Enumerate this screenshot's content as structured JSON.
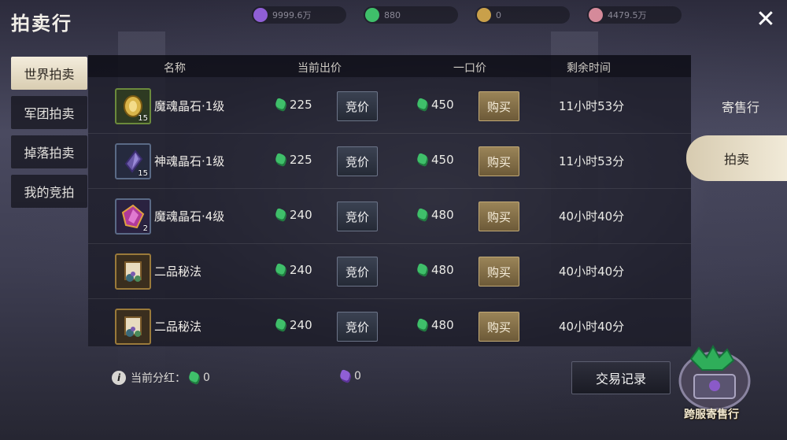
{
  "title": "拍卖行",
  "currencies": [
    {
      "value": "9999.6万",
      "color": "#8f5fd6",
      "icon": "purple-gem-icon"
    },
    {
      "value": "880",
      "color": "#3fbf6a",
      "icon": "green-gem-icon"
    },
    {
      "value": "0",
      "color": "#c9a04a",
      "icon": "gold-coin-icon"
    },
    {
      "value": "4479.5万",
      "color": "#d58a9a",
      "icon": "pink-orb-icon"
    }
  ],
  "left_tabs": [
    "世界拍卖",
    "军团拍卖",
    "掉落拍卖",
    "我的竞拍"
  ],
  "table": {
    "headers": {
      "name": "名称",
      "bid": "当前出价",
      "buyout": "一口价",
      "time": "剩余时间"
    },
    "bid_label": "竞价",
    "buy_label": "购买",
    "rows": [
      {
        "name": "魔魂晶石·1级",
        "count": "15",
        "bid": "225",
        "buyout": "450",
        "time": "11小时53分",
        "icon": "gold-crystal-icon",
        "frame": "#6b8a3c"
      },
      {
        "name": "神魂晶石·1级",
        "count": "15",
        "bid": "225",
        "buyout": "450",
        "time": "11小时53分",
        "icon": "purple-crystal-icon",
        "frame": "#5a6a86"
      },
      {
        "name": "魔魂晶石·4级",
        "count": "2",
        "bid": "240",
        "buyout": "480",
        "time": "40小时40分",
        "icon": "magenta-crystal-icon",
        "frame": "#5a6a86"
      },
      {
        "name": "二品秘法",
        "count": "",
        "bid": "240",
        "buyout": "480",
        "time": "40小时40分",
        "icon": "scroll-icon",
        "frame": "#9a7a3a"
      },
      {
        "name": "二品秘法",
        "count": "",
        "bid": "240",
        "buyout": "480",
        "time": "40小时40分",
        "icon": "scroll-icon",
        "frame": "#9a7a3a"
      }
    ]
  },
  "right_tabs": [
    "寄售行",
    "拍卖"
  ],
  "footer": {
    "dividend_label": "当前分红：",
    "green_value": "0",
    "purple_value": "0",
    "history_button": "交易记录",
    "cross_server_label": "跨服寄售行"
  }
}
